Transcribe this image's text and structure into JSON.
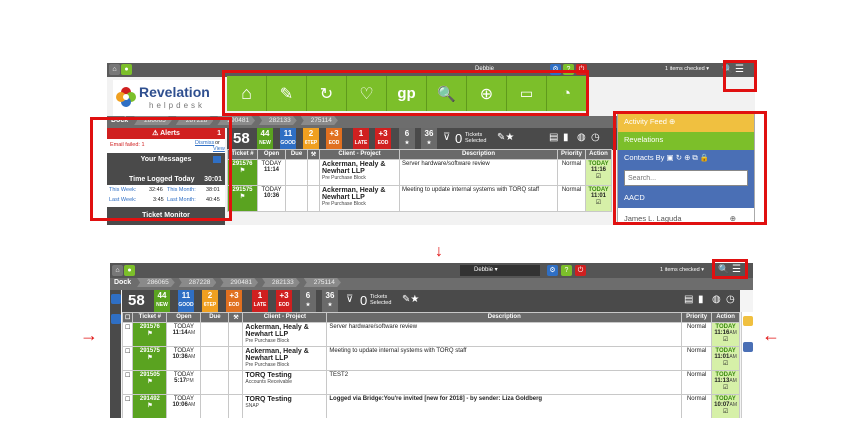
{
  "top": {
    "user": "Debbie",
    "items_checked": "1 items checked",
    "logo_name": "Revelation",
    "logo_sub": "helpdesk",
    "dock": "Dock",
    "tabs": [
      "286065",
      "287228",
      "290481",
      "282133",
      "275114"
    ],
    "alerts": {
      "title": "Alerts",
      "count": "1",
      "email_failed": "Email failed: 1",
      "dismiss": "Dismiss",
      "or": "or",
      "view": "View"
    },
    "messages": "Your Messages",
    "time_logged": {
      "title": "Time Logged Today",
      "value": "30:01",
      "this_week_label": "This Week:",
      "this_week": "32:46",
      "this_month_label": "This Month:",
      "this_month": "38:01",
      "last_week_label": "Last Week:",
      "last_week": "3:45",
      "last_month_label": "Last Month:",
      "last_month": "40:45"
    },
    "ticket_monitor": "Ticket Monitor",
    "menu": {
      "activity_feed": "Activity Feed",
      "revelations": "Revelations",
      "contacts_by": "Contacts By",
      "search_placeholder": "Search...",
      "aacd": "AACD",
      "person": "James L. Laguda"
    }
  },
  "counters": {
    "total": "58",
    "tiles": [
      {
        "n": "44",
        "l": "NEW",
        "color": "#5aa320"
      },
      {
        "n": "11",
        "l": "GOOD",
        "color": "#2f6fc4"
      },
      {
        "n": "2",
        "l": "6TEP",
        "color": "#f0a020"
      },
      {
        "n": "+3",
        "l": "EOD",
        "color": "#e07020"
      },
      {
        "n": "1",
        "l": "LATE",
        "color": "#d02020"
      },
      {
        "n": "+3",
        "l": "EOD",
        "color": "#d02020"
      },
      {
        "n": "6",
        "l": "★",
        "color": "#6a6a6a"
      },
      {
        "n": "36",
        "l": "★",
        "color": "#6a6a6a"
      }
    ],
    "tickets_selected_count": "0",
    "tickets_selected": "Tickets Selected"
  },
  "columns": [
    "Ticket #",
    "Open",
    "Due",
    "",
    "Client - Project",
    "Description",
    "Priority",
    "Action"
  ],
  "top_rows": [
    {
      "ticket": "291576",
      "open_day": "TODAY",
      "open_time": "11:14",
      "client": "Ackerman, Healy & Newhart LLP",
      "project": "Pre Purchase Block",
      "description": "Server hardware/software review",
      "priority": "Normal",
      "act_day": "TODAY",
      "act_time": "11:16"
    },
    {
      "ticket": "291575",
      "open_day": "TODAY",
      "open_time": "10:36",
      "client": "Ackerman, Healy & Newhart LLP",
      "project": "Pre Purchase Block",
      "description": "Meeting to update internal systems with TORQ staff",
      "priority": "Normal",
      "act_day": "TODAY",
      "act_time": "11:01"
    }
  ],
  "bottom_rows": [
    {
      "ticket": "291576",
      "open_day": "TODAY",
      "open_time": "11:14",
      "open_ampm": "AM",
      "client": "Ackerman, Healy & Newhart LLP",
      "project": "Pre Purchase Block",
      "description": "Server hardware/software review",
      "priority": "Normal",
      "act_day": "TODAY",
      "act_time": "11:16",
      "act_ampm": "AM"
    },
    {
      "ticket": "291575",
      "open_day": "TODAY",
      "open_time": "10:36",
      "open_ampm": "AM",
      "client": "Ackerman, Healy & Newhart LLP",
      "project": "Pre Purchase Block",
      "description": "Meeting to update internal systems with TORQ staff",
      "priority": "Normal",
      "act_day": "TODAY",
      "act_time": "11:01",
      "act_ampm": "AM"
    },
    {
      "ticket": "291505",
      "open_day": "TODAY",
      "open_time": "5:17",
      "open_ampm": "PM",
      "client": "TORQ Testing",
      "project": "Accounts Receivable",
      "description": "TEST2",
      "priority": "Normal",
      "act_day": "TODAY",
      "act_time": "11:13",
      "act_ampm": "AM"
    },
    {
      "ticket": "291492",
      "open_day": "TODAY",
      "open_time": "10:06",
      "open_ampm": "AM",
      "client": "TORQ Testing",
      "project": "SNAP",
      "description": "Logged via Bridge:You're invited [new for 2018] - by sender: Liza Goldberg",
      "priority": "Normal",
      "act_day": "TODAY",
      "act_time": "10:07",
      "act_ampm": "AM"
    }
  ],
  "colors": {
    "accent_green": "#7cbf2a",
    "red_highlight": "#e01010",
    "menu_yellow": "#f0c040",
    "menu_green": "#7cbf2a",
    "menu_blue": "#4a6fb5"
  }
}
